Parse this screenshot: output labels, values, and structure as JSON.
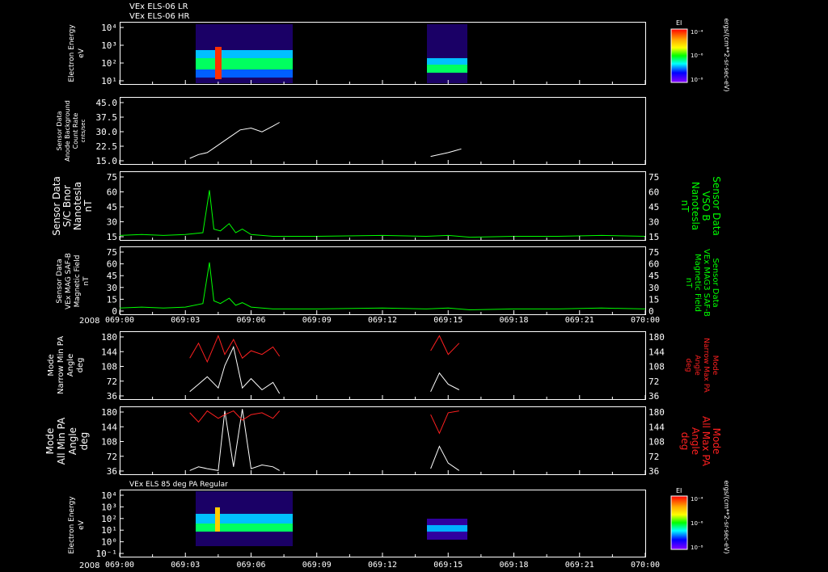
{
  "header": {
    "line1": "VEx ELS-06 LR",
    "line2": "VEx ELS-06 HR",
    "units_right": "ergs/(cm**2-sr-sec-eV)",
    "colorbar_label": "EI",
    "colorbar_ticks": [
      "10⁻⁴",
      "10⁻⁶",
      "10⁻⁸"
    ]
  },
  "colors": {
    "white": "#ffffff",
    "green": "#00ff00",
    "red": "#ff2020",
    "spectrogram_bg": "#2a00a0"
  },
  "time_axis": {
    "ticks": [
      "069:00",
      "069:03",
      "069:06",
      "069:09",
      "069:12",
      "069:15",
      "069:18",
      "069:21",
      "070:00"
    ],
    "year": "2008"
  },
  "panel_labels": {
    "p1": [
      "Electron Energy",
      "eV"
    ],
    "p2": [
      "Sensor Data",
      "Anode Background",
      "Count Rate",
      "cnts/sec"
    ],
    "p3": [
      "Sensor Data",
      "S/C Bnor",
      "Nanotesla",
      "nT"
    ],
    "p3_right": [
      "Sensor Data",
      "VSO B",
      "Nanotesla",
      "nT"
    ],
    "p4": [
      "Sensor Data",
      "VEx MAG SAF-B",
      "Magnetic Field",
      "nT"
    ],
    "p4_right": [
      "Sensor Data",
      "VEx MAG3 SAF-B",
      "Magnetic Field",
      "nT"
    ],
    "p5": [
      "Mode",
      "Narrow Min PA",
      "Angle",
      "deg"
    ],
    "p5_right": [
      "Mode",
      "Narrow Max PA",
      "Angle",
      "deg"
    ],
    "p6": [
      "Mode",
      "All Min PA",
      "Angle",
      "deg"
    ],
    "p6_right": [
      "Mode",
      "All Max PA",
      "Angle",
      "deg"
    ],
    "p7": [
      "Electron Energy",
      "eV"
    ]
  },
  "footer": {
    "p7_title": "VEx ELS 85 deg PA Regular"
  },
  "chart_data": [
    {
      "type": "heatmap",
      "title": "VEx ELS-06 HR",
      "ylabel": "Electron Energy eV",
      "yticks": [
        "10⁴",
        "10³",
        "10²",
        "10¹"
      ],
      "y_scale": "log",
      "x_range": [
        "069:00",
        "070:00"
      ],
      "data_intervals": [
        [
          "069:03",
          "069:07"
        ],
        [
          "069:14",
          "069:16"
        ]
      ]
    },
    {
      "type": "line",
      "ylabel": "Sensor Data Anode Background Count Rate cnts/sec",
      "yticks": [
        "45.0",
        "37.5",
        "30.0",
        "22.5",
        "15.0"
      ],
      "ylim": [
        10,
        45
      ],
      "series": [
        {
          "x": [
            3.2,
            3.6,
            4.0,
            4.5,
            5.0,
            5.5,
            6.0,
            6.5,
            7.0,
            7.3,
            14.2,
            14.6,
            15.0,
            15.3,
            15.6
          ],
          "values": [
            13,
            15,
            16,
            20,
            24,
            28,
            29,
            27,
            30,
            32,
            14,
            15,
            16,
            17,
            18
          ]
        }
      ]
    },
    {
      "type": "line",
      "ylabel": "Sensor Data S/C Bnor Nanotesla nT",
      "yticks": [
        "75",
        "60",
        "45",
        "30",
        "15"
      ],
      "ylim": [
        0,
        75
      ],
      "series": [
        {
          "x": [
            0,
            1,
            2,
            3,
            3.8,
            4.1,
            4.3,
            4.6,
            5.0,
            5.3,
            5.6,
            6.0,
            6.5,
            7,
            9,
            12,
            14,
            15,
            16,
            18,
            20,
            22,
            24
          ],
          "values": [
            5,
            6,
            5,
            6,
            8,
            55,
            12,
            10,
            18,
            8,
            12,
            6,
            5,
            4,
            4,
            5,
            4,
            5,
            3,
            4,
            4,
            5,
            4
          ]
        }
      ]
    },
    {
      "type": "line",
      "ylabel": "Sensor Data VEx MAG SAF-B Magnetic Field nT",
      "yticks": [
        "75",
        "60",
        "45",
        "30",
        "15",
        "0"
      ],
      "ylim": [
        0,
        75
      ],
      "series": [
        {
          "x": [
            0,
            1,
            2,
            3,
            3.8,
            4.1,
            4.3,
            4.6,
            5.0,
            5.3,
            5.6,
            6.0,
            6.5,
            7,
            9,
            12,
            14,
            15,
            16,
            18,
            20,
            22,
            24
          ],
          "values": [
            7,
            8,
            7,
            8,
            12,
            58,
            15,
            12,
            18,
            10,
            13,
            8,
            7,
            6,
            6,
            7,
            6,
            7,
            5,
            6,
            6,
            7,
            6
          ]
        }
      ]
    },
    {
      "type": "line",
      "ylabel": "Mode Narrow Min PA Angle deg",
      "yticks": [
        "180",
        "144",
        "108",
        "72",
        "36"
      ],
      "ylim": [
        0,
        180
      ],
      "series": [
        {
          "x": [
            3.2,
            3.6,
            4.0,
            4.5,
            4.8,
            5.2,
            5.6,
            6.0,
            6.5,
            7.0,
            7.3,
            14.2,
            14.6,
            15.0,
            15.5
          ],
          "values": [
            20,
            40,
            60,
            30,
            90,
            140,
            30,
            55,
            25,
            45,
            15,
            20,
            70,
            40,
            25
          ]
        },
        {
          "x": [
            3.2,
            3.6,
            4.0,
            4.5,
            4.8,
            5.2,
            5.6,
            6.0,
            6.5,
            7.0,
            7.3,
            14.2,
            14.6,
            15.0,
            15.5
          ],
          "values": [
            110,
            150,
            100,
            170,
            120,
            160,
            110,
            130,
            120,
            140,
            115,
            130,
            170,
            120,
            150
          ]
        }
      ]
    },
    {
      "type": "line",
      "ylabel": "Mode All Min PA Angle deg",
      "yticks": [
        "180",
        "144",
        "108",
        "72",
        "36"
      ],
      "ylim": [
        0,
        180
      ],
      "series": [
        {
          "x": [
            3.2,
            3.6,
            4.0,
            4.5,
            4.8,
            5.2,
            5.6,
            6.0,
            6.5,
            7.0,
            7.3,
            14.2,
            14.6,
            15.0,
            15.5
          ],
          "values": [
            10,
            20,
            15,
            10,
            170,
            20,
            175,
            15,
            25,
            20,
            10,
            15,
            75,
            30,
            10
          ]
        },
        {
          "x": [
            3.2,
            3.6,
            4.0,
            4.5,
            4.8,
            5.2,
            5.6,
            6.0,
            6.5,
            7.0,
            7.3,
            14.2,
            14.6,
            15.0,
            15.5
          ],
          "values": [
            165,
            140,
            170,
            150,
            160,
            170,
            145,
            160,
            165,
            150,
            170,
            160,
            110,
            165,
            170
          ]
        }
      ]
    },
    {
      "type": "heatmap",
      "title": "VEx ELS 85 deg PA Regular",
      "ylabel": "Electron Energy eV",
      "yticks": [
        "10⁴",
        "10³",
        "10²",
        "10¹",
        "10⁰",
        "10⁻¹"
      ],
      "y_scale": "log",
      "x_range": [
        "069:00",
        "070:00"
      ],
      "data_intervals": [
        [
          "069:03",
          "069:07"
        ],
        [
          "069:14",
          "069:16"
        ]
      ]
    }
  ]
}
